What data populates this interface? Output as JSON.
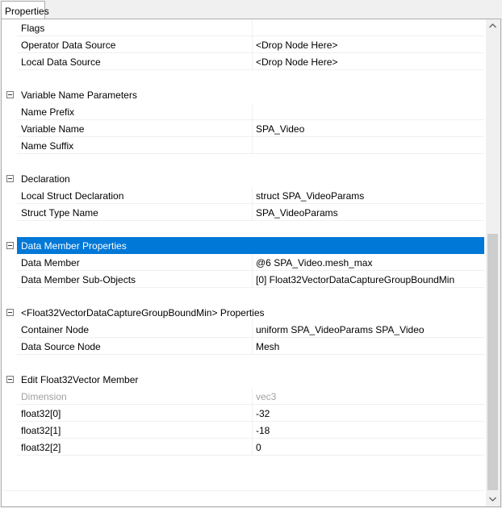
{
  "tab": {
    "label": "Properties"
  },
  "groups": [
    {
      "title": "",
      "rows": [
        {
          "name": "Flags",
          "value": ""
        },
        {
          "name": "Operator Data Source",
          "value": "<Drop Node Here>"
        },
        {
          "name": "Local Data Source",
          "value": "<Drop Node Here>"
        }
      ]
    },
    {
      "title": "Variable Name Parameters",
      "rows": [
        {
          "name": "Name Prefix",
          "value": ""
        },
        {
          "name": "Variable Name",
          "value": "SPA_Video"
        },
        {
          "name": "Name Suffix",
          "value": ""
        }
      ]
    },
    {
      "title": "Declaration",
      "rows": [
        {
          "name": "Local Struct Declaration",
          "value": "struct SPA_VideoParams"
        },
        {
          "name": "Struct Type Name",
          "value": "SPA_VideoParams"
        }
      ]
    },
    {
      "title": "Data Member Properties",
      "selected": true,
      "rows": [
        {
          "name": "Data Member",
          "value": "@6 SPA_Video.mesh_max"
        },
        {
          "name": "Data Member Sub-Objects",
          "value": "[0] Float32VectorDataCaptureGroupBoundMin"
        }
      ]
    },
    {
      "title": "<Float32VectorDataCaptureGroupBoundMin> Properties",
      "rows": [
        {
          "name": "Container Node",
          "value": "uniform SPA_VideoParams SPA_Video"
        },
        {
          "name": "Data Source Node",
          "value": "Mesh"
        }
      ]
    },
    {
      "title": "Edit Float32Vector Member",
      "rows": [
        {
          "name": "Dimension",
          "value": "vec3",
          "disabled": true
        },
        {
          "name": "float32[0]",
          "value": "-32"
        },
        {
          "name": "float32[1]",
          "value": "-18"
        },
        {
          "name": "float32[2]",
          "value": "0"
        }
      ]
    }
  ]
}
